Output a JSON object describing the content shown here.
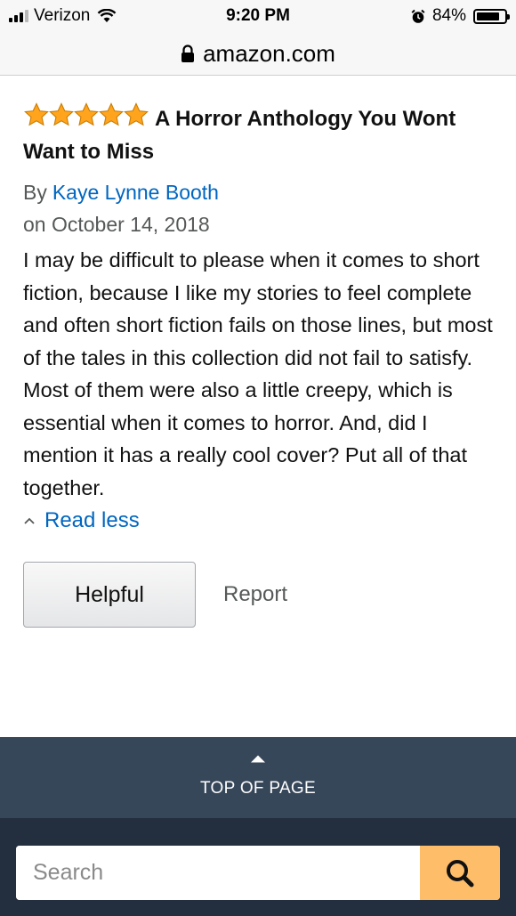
{
  "status_bar": {
    "carrier": "Verizon",
    "time": "9:20 PM",
    "battery_percent": "84%",
    "battery_level": 0.84,
    "signal_bars": 3
  },
  "url_bar": {
    "domain": "amazon.com"
  },
  "review": {
    "rating": 5,
    "title": "A Horror Anthology You Wont Want to Miss",
    "by_label": "By",
    "author": "Kaye Lynne Booth",
    "date": "on October 14, 2018",
    "body": "I may be difficult to please when it comes to short fiction, because I like my stories to feel complete and often short fiction fails on those lines, but most of the tales in this collection did not fail to satisfy. Most of them were also a little creepy, which is essential when it comes to horror. And, did I mention it has a really cool cover? Put all of that together.",
    "read_less": "Read less",
    "helpful_label": "Helpful",
    "report_label": "Report"
  },
  "footer": {
    "back_to_top": "TOP OF PAGE",
    "search_placeholder": "Search"
  },
  "colors": {
    "link": "#0066c0",
    "star": "#ffa41c",
    "footer_top": "#37475a",
    "footer_search": "#232f3e",
    "search_button": "#febd69"
  }
}
